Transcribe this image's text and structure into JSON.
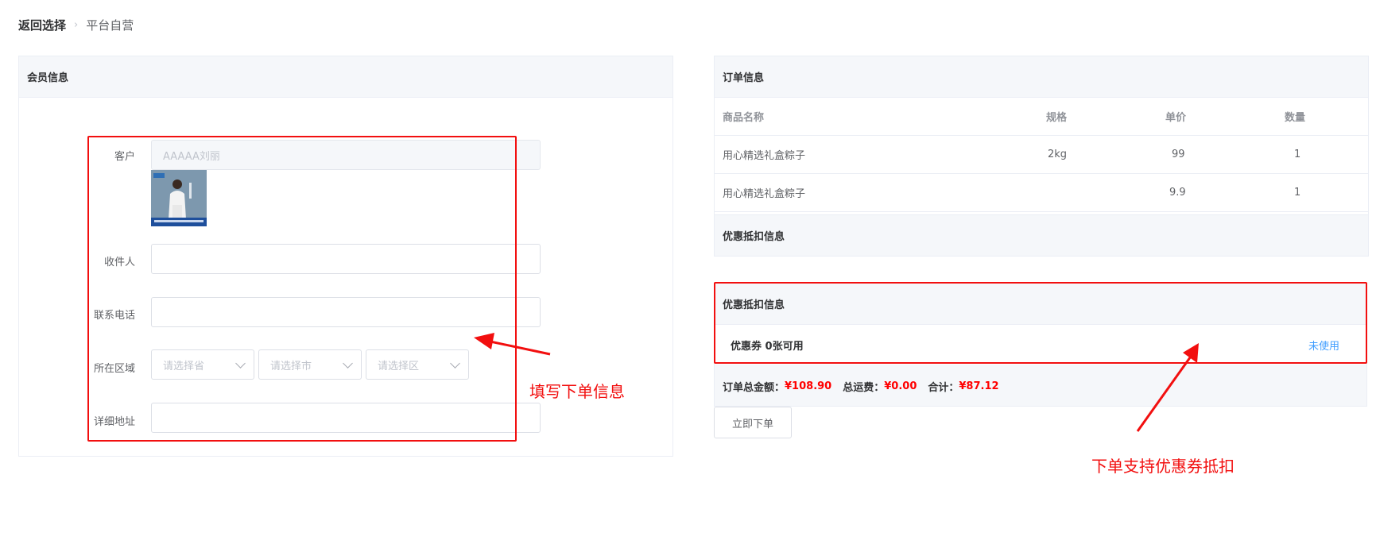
{
  "breadcrumb": {
    "back": "返回选择",
    "separator": "›",
    "current": "平台自营"
  },
  "member": {
    "title": "会员信息",
    "customer_label": "客户",
    "customer_value": "AAAAA刘丽",
    "recipient_label": "收件人",
    "recipient_value": "",
    "phone_label": "联系电话",
    "phone_value": "",
    "region_label": "所在区域",
    "province_placeholder": "请选择省",
    "city_placeholder": "请选择市",
    "district_placeholder": "请选择区",
    "address_label": "详细地址",
    "address_value": ""
  },
  "order": {
    "title": "订单信息",
    "columns": [
      "商品名称",
      "规格",
      "单价",
      "数量"
    ],
    "rows": [
      {
        "name": "用心精选礼盒粽子",
        "spec": "2kg",
        "price": "99",
        "qty": "1"
      },
      {
        "name": "用心精选礼盒粽子",
        "spec": "",
        "price": "9.9",
        "qty": "1"
      }
    ],
    "discount_title": "优惠抵扣信息"
  },
  "coupon": {
    "title": "优惠抵扣信息",
    "label": "优惠券 0张可用",
    "status": "未使用",
    "total_label": "订单总金额：",
    "total_value": "¥108.90",
    "shipping_label": "总运费：",
    "shipping_value": "¥0.00",
    "sum_label": "合计：",
    "sum_value": "¥87.12"
  },
  "submit_label": "立即下单",
  "annotations": {
    "fill_info": "填写下单信息",
    "coupon_support": "下单支持优惠券抵扣"
  },
  "colors": {
    "annotation_red": "#f20f0f",
    "link_blue": "#409eff",
    "price_red": "#ff0000"
  }
}
